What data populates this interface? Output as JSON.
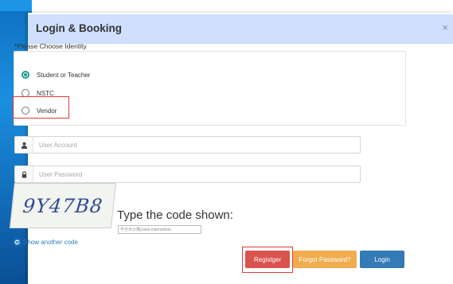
{
  "modal": {
    "title": "Login & Booking",
    "close_label": "×"
  },
  "identity": {
    "label": "*Please Choose Identity",
    "options": [
      {
        "label": "Student or Teacher",
        "checked": true
      },
      {
        "label": "NSTC",
        "checked": false
      },
      {
        "label": "Vendor",
        "checked": false
      }
    ]
  },
  "fields": {
    "account_placeholder": "User Account",
    "password_placeholder": "User Password"
  },
  "captcha": {
    "code": "9Y47B8",
    "prompt": "Type the code shown:",
    "input_placeholder": "不分大小寫(case-insensitive)",
    "refresh_label": "Show another code"
  },
  "buttons": {
    "register": "Registger",
    "forgot": "Forgot Password?",
    "login": "Login"
  },
  "colors": {
    "header_bg": "#cfe0ff",
    "radio_checked": "#1e9d8b",
    "register": "#d9534f",
    "forgot": "#f0ad4e",
    "login": "#337ab7",
    "highlight_outline": "#e23a3a"
  }
}
